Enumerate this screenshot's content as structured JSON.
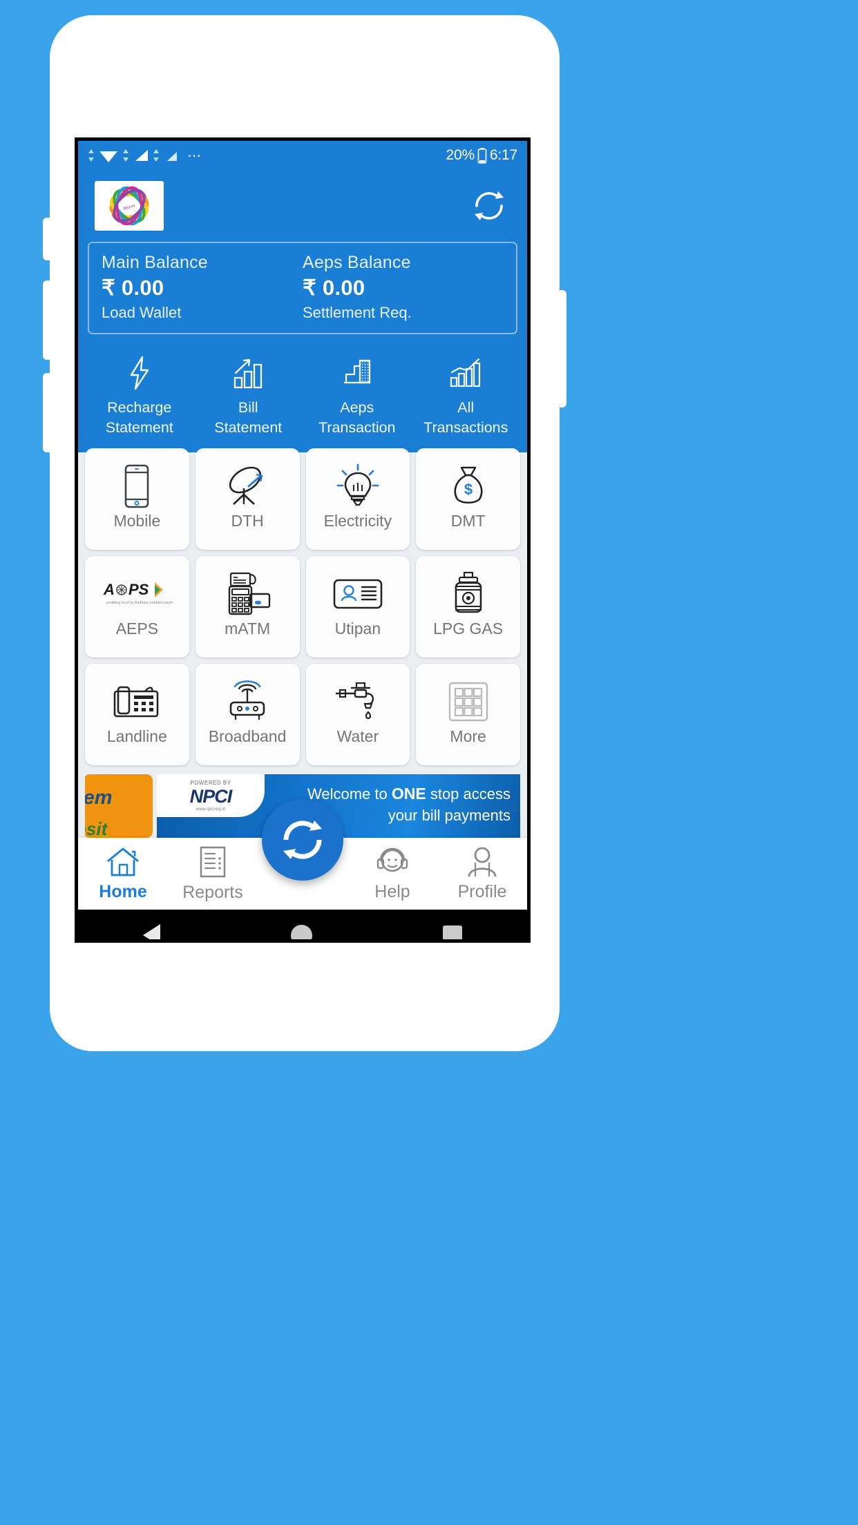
{
  "statusbar": {
    "battery_percent": "20%",
    "time": "6:17",
    "overflow_dots": "⋯"
  },
  "header": {
    "logo_alt": "brand-logo",
    "refresh_label": "refresh"
  },
  "balance": {
    "main": {
      "title": "Main Balance",
      "amount": "₹ 0.00",
      "action": "Load Wallet"
    },
    "aeps": {
      "title": "Aeps Balance",
      "amount": "₹ 0.00",
      "action": "Settlement Req."
    }
  },
  "quick_actions": [
    {
      "icon": "lightning-bolt-icon",
      "line1": "Recharge",
      "line2": "Statement"
    },
    {
      "icon": "bar-chart-up-icon",
      "line1": "Bill",
      "line2": "Statement"
    },
    {
      "icon": "aeps-chart-icon",
      "line1": "Aeps",
      "line2": "Transaction"
    },
    {
      "icon": "all-chart-icon",
      "line1": "All",
      "line2": "Transactions"
    }
  ],
  "services": [
    {
      "label": "Mobile",
      "icon": "smartphone-icon"
    },
    {
      "label": "DTH",
      "icon": "satellite-dish-icon"
    },
    {
      "label": "Electricity",
      "icon": "light-bulb-icon"
    },
    {
      "label": "DMT",
      "icon": "money-bag-icon"
    },
    {
      "label": "AEPS",
      "icon": "aeps-logo-icon"
    },
    {
      "label": "mATM",
      "icon": "pos-terminal-icon"
    },
    {
      "label": "Utipan",
      "icon": "id-card-icon"
    },
    {
      "label": "LPG GAS",
      "icon": "gas-cylinder-icon"
    },
    {
      "label": "Landline",
      "icon": "desk-phone-icon"
    },
    {
      "label": "Broadband",
      "icon": "wifi-router-icon"
    },
    {
      "label": "Water",
      "icon": "water-tap-icon"
    },
    {
      "label": "More",
      "icon": "grid-dots-icon"
    }
  ],
  "banner": {
    "left_card": {
      "text_top": "tem",
      "text_bottom": "osit"
    },
    "npci": {
      "powered_by": "POWERED BY",
      "name": "NPCI",
      "tagline": "www.npci.org.in"
    },
    "headline_1_prefix": "Welcome to ",
    "headline_1_bold": "ONE",
    "headline_1_suffix": " stop access",
    "headline_2": "your bill payments"
  },
  "bottom_nav": {
    "items": [
      {
        "label": "Home",
        "icon": "home-icon",
        "active": true
      },
      {
        "label": "Reports",
        "icon": "report-icon",
        "active": false
      },
      {
        "label": "Help",
        "icon": "headset-icon",
        "active": false
      },
      {
        "label": "Profile",
        "icon": "person-icon",
        "active": false
      }
    ],
    "fab": {
      "icon": "refresh-circle-icon",
      "label": "refresh"
    }
  },
  "android_nav": {
    "back": "back-button",
    "home": "home-button",
    "recents": "recents-button"
  },
  "colors": {
    "brand_blue": "#1a7fd4",
    "page_blue": "#3ba3ea",
    "fab_blue": "#1b72cc",
    "tile_white": "#fdfdfd",
    "label_gray": "#757575"
  }
}
